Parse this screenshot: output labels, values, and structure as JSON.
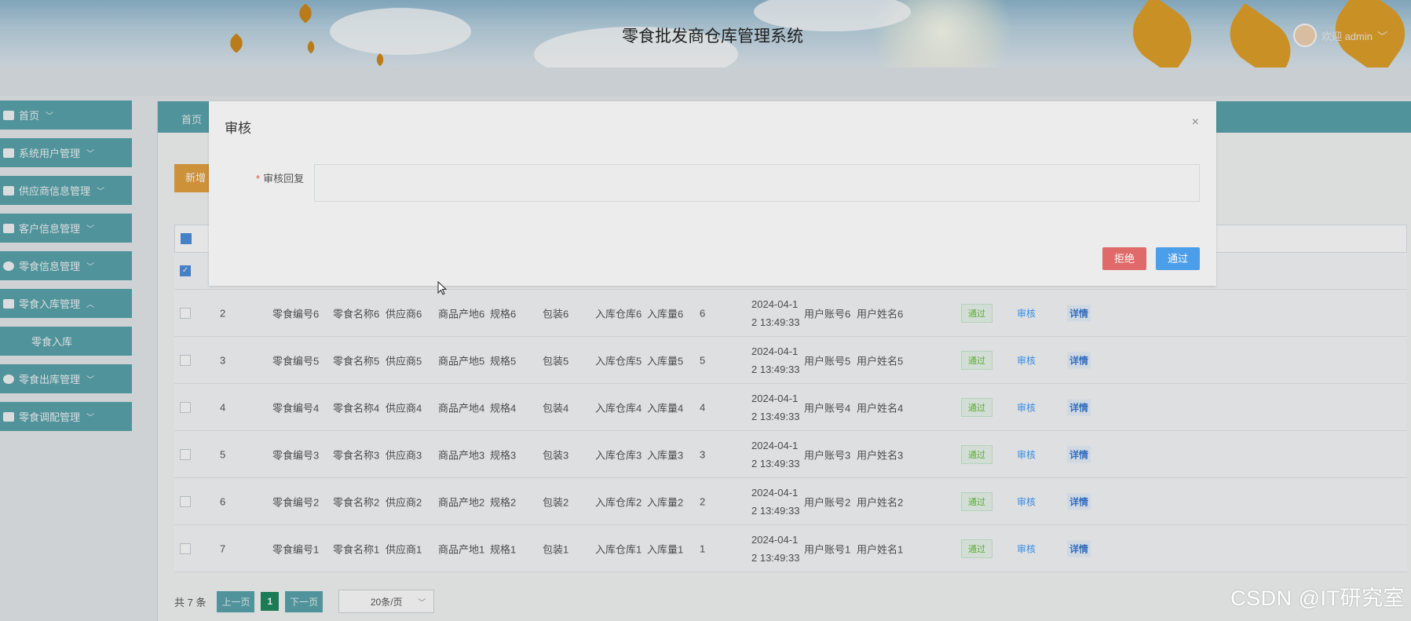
{
  "header": {
    "system_title": "零食批发商仓库管理系统",
    "welcome_text": "欢迎 admin"
  },
  "sidebar": {
    "items": [
      {
        "label": "首页",
        "icon": "home-icon",
        "expanded": false
      },
      {
        "label": "系统用户管理",
        "icon": "user-icon",
        "expanded": false
      },
      {
        "label": "供应商信息管理",
        "icon": "book-icon",
        "expanded": false
      },
      {
        "label": "客户信息管理",
        "icon": "grid-icon",
        "expanded": false
      },
      {
        "label": "零食信息管理",
        "icon": "check-circle-icon",
        "expanded": false
      },
      {
        "label": "零食入库管理",
        "icon": "apps-icon",
        "expanded": true
      },
      {
        "label": "零食入库",
        "sub": true
      },
      {
        "label": "零食出库管理",
        "icon": "check-circle-icon",
        "expanded": false
      },
      {
        "label": "零食调配管理",
        "icon": "list-icon",
        "expanded": false
      }
    ]
  },
  "main": {
    "tab_home": "首页",
    "add_button": "新增"
  },
  "table": {
    "rows": [
      {
        "idx": "2",
        "code": "零食编号6",
        "name": "零食名称6",
        "supplier": "供应商6",
        "origin": "商品产地6",
        "spec": "规格6",
        "pack": "包装6",
        "warehouse": "入库仓库6",
        "qty_label": "入库量6",
        "qty": "6",
        "date_a": "2024-04-1",
        "date_b": "2 13:49:33",
        "account": "用户账号6",
        "username": "用户姓名6",
        "status": "通过",
        "audit": "审核",
        "detail": "详情"
      },
      {
        "idx": "3",
        "code": "零食编号5",
        "name": "零食名称5",
        "supplier": "供应商5",
        "origin": "商品产地5",
        "spec": "规格5",
        "pack": "包装5",
        "warehouse": "入库仓库5",
        "qty_label": "入库量5",
        "qty": "5",
        "date_a": "2024-04-1",
        "date_b": "2 13:49:33",
        "account": "用户账号5",
        "username": "用户姓名5",
        "status": "通过",
        "audit": "审核",
        "detail": "详情"
      },
      {
        "idx": "4",
        "code": "零食编号4",
        "name": "零食名称4",
        "supplier": "供应商4",
        "origin": "商品产地4",
        "spec": "规格4",
        "pack": "包装4",
        "warehouse": "入库仓库4",
        "qty_label": "入库量4",
        "qty": "4",
        "date_a": "2024-04-1",
        "date_b": "2 13:49:33",
        "account": "用户账号4",
        "username": "用户姓名4",
        "status": "通过",
        "audit": "审核",
        "detail": "详情"
      },
      {
        "idx": "5",
        "code": "零食编号3",
        "name": "零食名称3",
        "supplier": "供应商3",
        "origin": "商品产地3",
        "spec": "规格3",
        "pack": "包装3",
        "warehouse": "入库仓库3",
        "qty_label": "入库量3",
        "qty": "3",
        "date_a": "2024-04-1",
        "date_b": "2 13:49:33",
        "account": "用户账号3",
        "username": "用户姓名3",
        "status": "通过",
        "audit": "审核",
        "detail": "详情"
      },
      {
        "idx": "6",
        "code": "零食编号2",
        "name": "零食名称2",
        "supplier": "供应商2",
        "origin": "商品产地2",
        "spec": "规格2",
        "pack": "包装2",
        "warehouse": "入库仓库2",
        "qty_label": "入库量2",
        "qty": "2",
        "date_a": "2024-04-1",
        "date_b": "2 13:49:33",
        "account": "用户账号2",
        "username": "用户姓名2",
        "status": "通过",
        "audit": "审核",
        "detail": "详情"
      },
      {
        "idx": "7",
        "code": "零食编号1",
        "name": "零食名称1",
        "supplier": "供应商1",
        "origin": "商品产地1",
        "spec": "规格1",
        "pack": "包装1",
        "warehouse": "入库仓库1",
        "qty_label": "入库量1",
        "qty": "1",
        "date_a": "2024-04-1",
        "date_b": "2 13:49:33",
        "account": "用户账号1",
        "username": "用户姓名1",
        "status": "通过",
        "audit": "审核",
        "detail": "详情"
      }
    ]
  },
  "pager": {
    "total": "共 7 条",
    "prev": "上一页",
    "current": "1",
    "next": "下一页",
    "page_size": "20条/页"
  },
  "dialog": {
    "title": "审核",
    "close_glyph": "×",
    "field_label": "审核回复",
    "required_mark": "*",
    "reply_value": "",
    "reject_label": "拒绝",
    "pass_label": "通过"
  },
  "watermark": "CSDN @IT研究室",
  "colors": {
    "sidebar": "#5aa4ad",
    "add_button": "#e5a240",
    "reject": "#e06a6a",
    "pass": "#4b9ee9",
    "status_pass": "#67c23a"
  }
}
